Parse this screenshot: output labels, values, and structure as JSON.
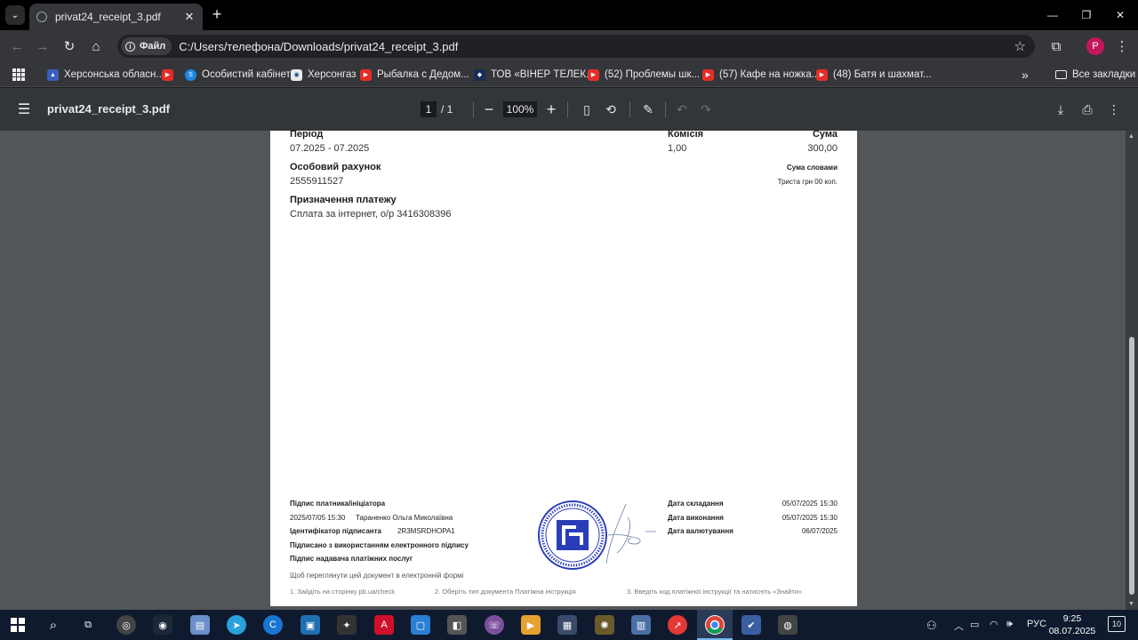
{
  "browser": {
    "tab_title": "privat24_receipt_3.pdf",
    "address_chip": "Файл",
    "url": "C:/Users/телефона/Downloads/privat24_receipt_3.pdf",
    "avatar_letter": "P"
  },
  "bookmarks": [
    {
      "label": "Херсонська обласн...",
      "icon": "region-icon"
    },
    {
      "label": "",
      "icon": "youtube-icon"
    },
    {
      "label": "Особистий кабінет",
      "icon": "account-icon"
    },
    {
      "label": "Херсонгаз",
      "icon": "gas-icon"
    },
    {
      "label": "Рыбалка с Дедом...",
      "icon": "youtube-icon"
    },
    {
      "label": "ТОВ «ВІНЕР ТЕЛЕК...",
      "icon": "company-icon"
    },
    {
      "label": "(52) Проблемы шк...",
      "icon": "youtube-icon"
    },
    {
      "label": "(57) Кафе на ножка...",
      "icon": "youtube-icon"
    },
    {
      "label": "(48) Батя и шахмат...",
      "icon": "youtube-icon"
    }
  ],
  "bookmarks_more": "»",
  "all_bookmarks": "Все закладки",
  "pdf": {
    "file_name": "privat24_receipt_3.pdf",
    "page_current": "1",
    "page_total": "/   1",
    "zoom": "100%"
  },
  "receipt": {
    "period_label": "Період",
    "period_value": "07.2025 - 07.2025",
    "commission_label": "Комісія",
    "commission_value": "1,00",
    "sum_label": "Сума",
    "sum_value": "300,00",
    "account_label": "Особовий рахунок",
    "account_value": "2555911527",
    "sum_words_label": "Сума словами",
    "sum_words_value": "Триста грн 00 коп.",
    "purpose_label": "Призначення платежу",
    "purpose_value": "Сплата за інтернет, о/р 3416308396",
    "payer_sign_label": "Підпис платника/ініціатора",
    "payer_sign_time": "2025/07/05 15:30",
    "payer_name": "Тараненко Ольга Миколаївна",
    "signer_id_label": "Ідентифікатор підписанта",
    "signer_id_value": "2R3MSRDHOPA1",
    "e_sign_note": "Підписано з використанням електронного підпису",
    "provider_sign_label": "Підпис надавача платіжних послуг",
    "date_created_label": "Дата складання",
    "date_created_value": "05/07/2025 15:30",
    "date_executed_label": "Дата виконання",
    "date_executed_value": "05/07/2025 15:30",
    "date_value_label": "Дата валютування",
    "date_value_value": "06/07/2025",
    "view_note": "Щоб переглянути цей документ в електронній формі",
    "step1": "1. Зайдіть на сторінку pb.ua/check",
    "step2": "2. Оберіть тип документа Платіжна інструкція",
    "step3": "3. Введіть код платіжної інструкції та натисніть «Знайти»"
  },
  "taskbar": {
    "lang": "РУС",
    "time": "9:25",
    "date": "08.07.2025",
    "notifications": "10"
  },
  "colors": {
    "stamp_blue": "#2a3db8",
    "chrome_dark": "#202124",
    "pdf_gray": "#525659"
  }
}
